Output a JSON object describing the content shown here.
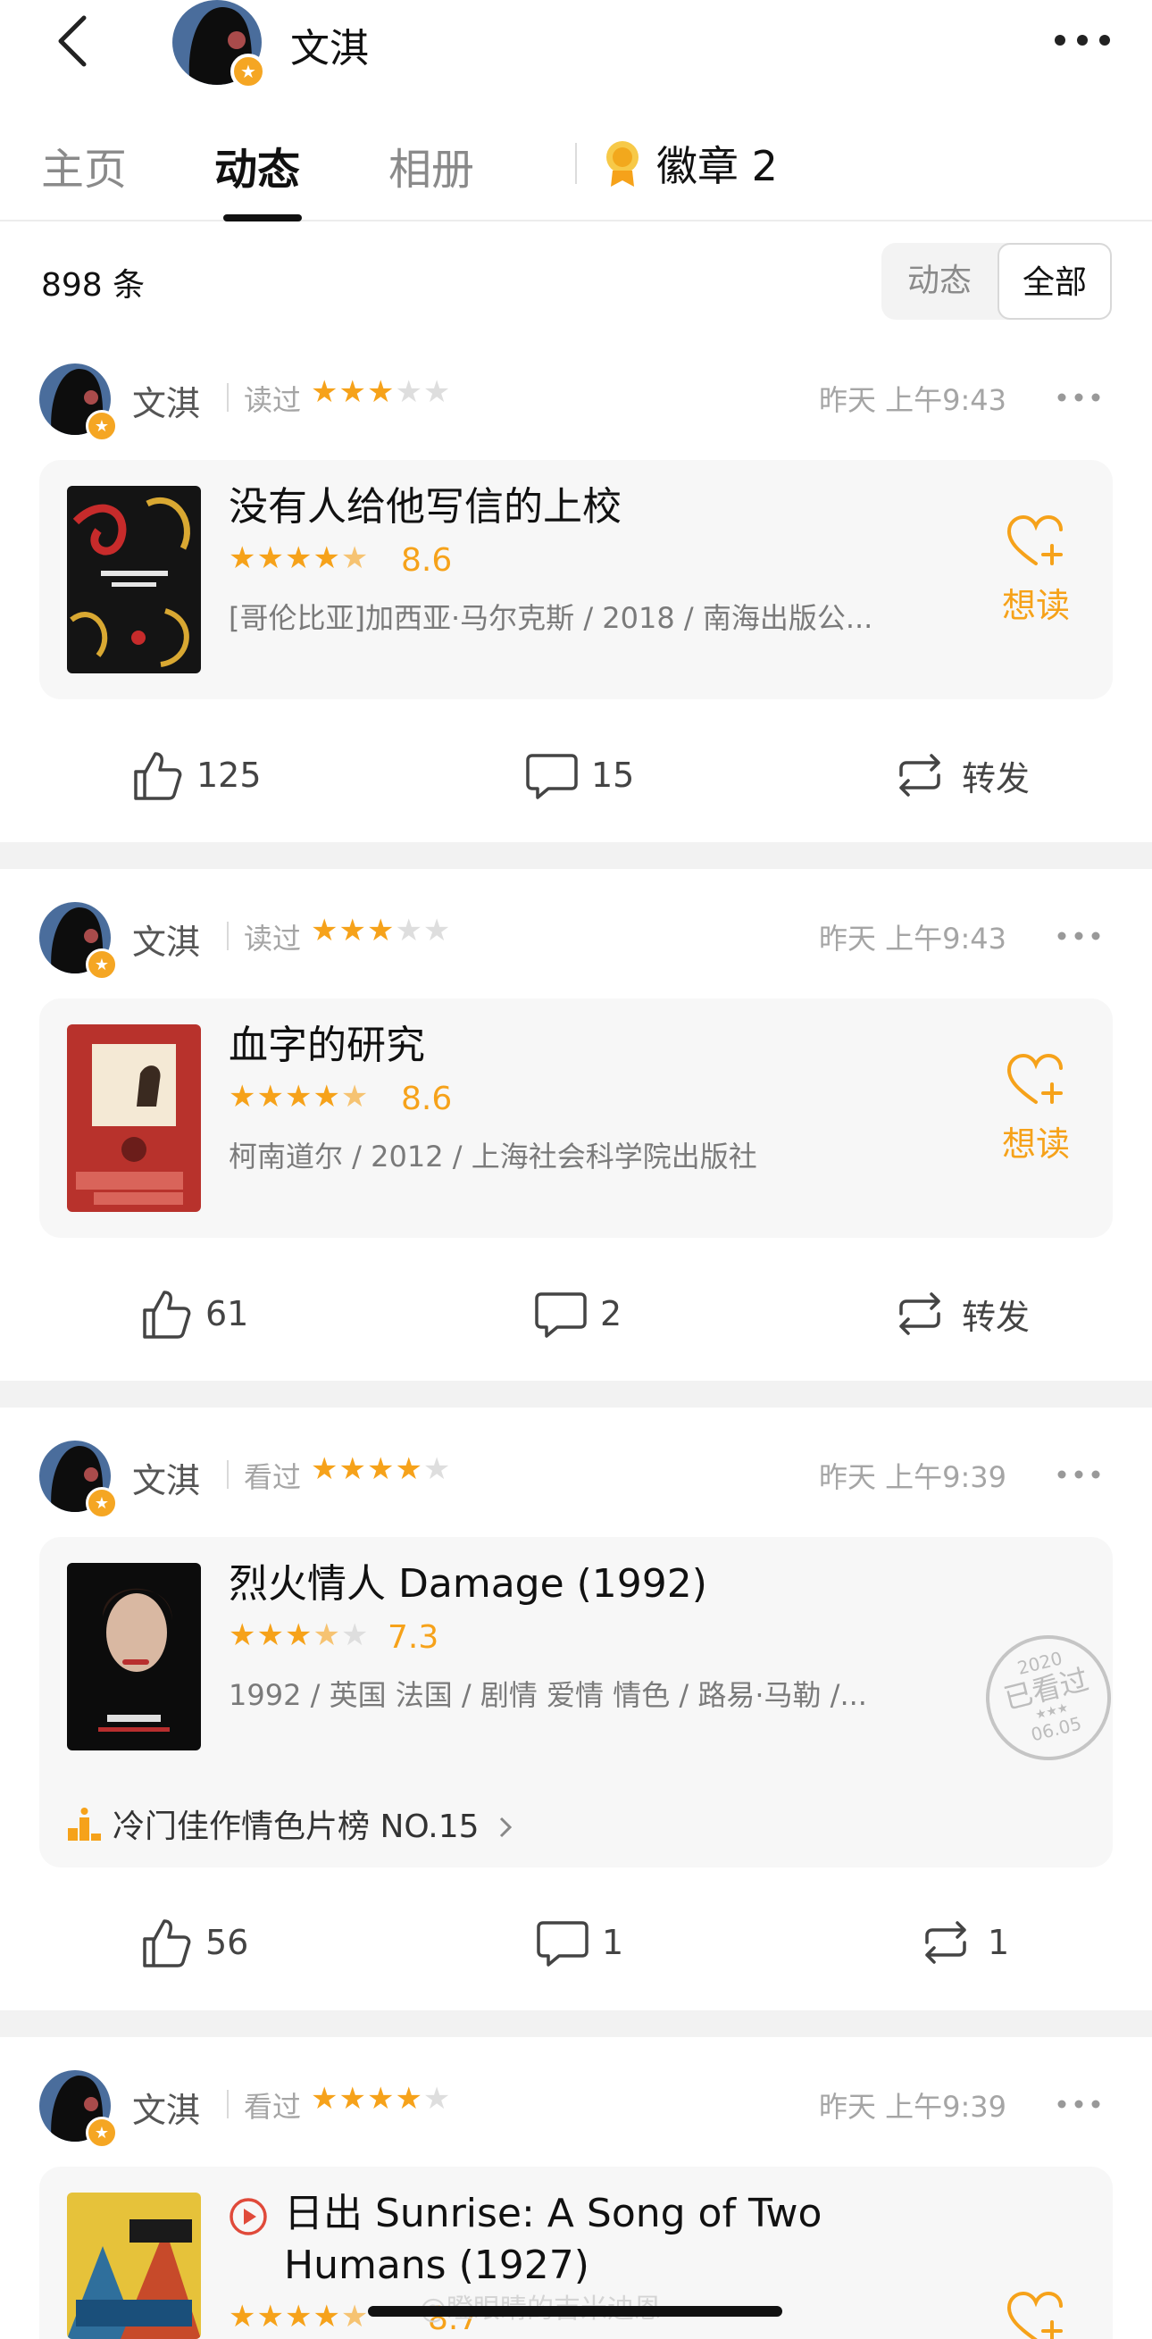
{
  "header": {
    "name": "文淇"
  },
  "tabs": [
    "主页",
    "动态",
    "相册"
  ],
  "badges_label": "徽章 2",
  "count": "898 条",
  "filter": {
    "off": "动态",
    "on": "全部"
  },
  "posts": [
    {
      "user": "文淇",
      "action": "读过",
      "user_stars": 3,
      "time": "昨天 上午9:43",
      "title": "没有人给他写信的上校",
      "rating_stars": 4.5,
      "rating": "8.6",
      "meta": "[哥伦比亚]加西亚·马尔克斯 / 2018 / 南海出版公...",
      "wish": "想读",
      "likes": "125",
      "comments": "15",
      "share": "转发"
    },
    {
      "user": "文淇",
      "action": "读过",
      "user_stars": 3,
      "time": "昨天 上午9:43",
      "title": "血字的研究",
      "rating_stars": 4.5,
      "rating": "8.6",
      "meta": "柯南道尔 / 2012 / 上海社会科学院出版社",
      "wish": "想读",
      "likes": "61",
      "comments": "2",
      "share": "转发"
    },
    {
      "user": "文淇",
      "action": "看过",
      "user_stars": 4,
      "time": "昨天 上午9:39",
      "title": "烈火情人 Damage (1992)",
      "rating_stars": 3.5,
      "rating": "7.3",
      "meta": "1992 / 英国 法国 / 剧情 爱情 情色 / 路易·马勒 /...",
      "rank": "冷门佳作情色片榜 NO.15",
      "stamp": {
        "year": "2020",
        "text": "已看过",
        "date": "06.05"
      },
      "likes": "56",
      "comments": "1",
      "share": "1"
    },
    {
      "user": "文淇",
      "action": "看过",
      "user_stars": 4,
      "time": "昨天 上午9:39",
      "title": "日出 Sunrise: A Song of Two Humans (1927)",
      "rating_stars": 4.5,
      "rating": "8.7"
    }
  ],
  "watermark": "@瞪眼睛的吉米迪恩",
  "colors": {
    "accent": "#f6a21a",
    "badge": "#f5a623",
    "gap": "#f2f2f2"
  }
}
